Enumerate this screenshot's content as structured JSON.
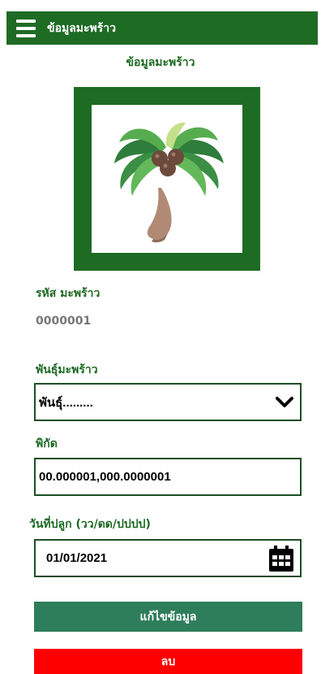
{
  "header": {
    "title": "ข้อมูลมะพร้าว",
    "menu_icon": "hamburger-menu-icon"
  },
  "page": {
    "title": "ข้อมูลมะพร้าว",
    "image_icon": "coconut-tree-icon"
  },
  "fields": {
    "code_label": "รหัส มะพร้าว",
    "code_value": "0000001",
    "variety_label": "พันธุ์มะพร้าว",
    "variety_value": "พันธุ์.........",
    "location_label": "พิกัด",
    "location_value": "00.000001,000.0000001",
    "plant_date_label": "วันที่ปลูก (วว/ดด/ปปปป)",
    "plant_date_value": "01/01/2021"
  },
  "icons": {
    "dropdown": "chevron-down-icon",
    "calendar": "calendar-icon"
  },
  "buttons": {
    "edit_label": "แก้ไขข้อมูล",
    "delete_label": "ลบ"
  },
  "colors": {
    "primary_green": "#1e6b24",
    "edit_button": "#2e7d5b",
    "delete_button": "#ff0000"
  }
}
